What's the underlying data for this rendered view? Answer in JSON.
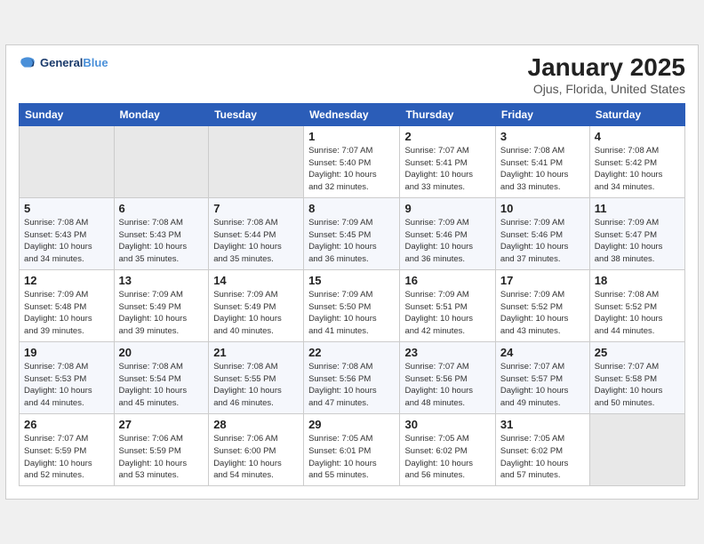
{
  "logo": {
    "text_general": "General",
    "text_blue": "Blue"
  },
  "title": "January 2025",
  "subtitle": "Ojus, Florida, United States",
  "weekdays": [
    "Sunday",
    "Monday",
    "Tuesday",
    "Wednesday",
    "Thursday",
    "Friday",
    "Saturday"
  ],
  "weeks": [
    [
      {
        "day": "",
        "info": ""
      },
      {
        "day": "",
        "info": ""
      },
      {
        "day": "",
        "info": ""
      },
      {
        "day": "1",
        "info": "Sunrise: 7:07 AM\nSunset: 5:40 PM\nDaylight: 10 hours\nand 32 minutes."
      },
      {
        "day": "2",
        "info": "Sunrise: 7:07 AM\nSunset: 5:41 PM\nDaylight: 10 hours\nand 33 minutes."
      },
      {
        "day": "3",
        "info": "Sunrise: 7:08 AM\nSunset: 5:41 PM\nDaylight: 10 hours\nand 33 minutes."
      },
      {
        "day": "4",
        "info": "Sunrise: 7:08 AM\nSunset: 5:42 PM\nDaylight: 10 hours\nand 34 minutes."
      }
    ],
    [
      {
        "day": "5",
        "info": "Sunrise: 7:08 AM\nSunset: 5:43 PM\nDaylight: 10 hours\nand 34 minutes."
      },
      {
        "day": "6",
        "info": "Sunrise: 7:08 AM\nSunset: 5:43 PM\nDaylight: 10 hours\nand 35 minutes."
      },
      {
        "day": "7",
        "info": "Sunrise: 7:08 AM\nSunset: 5:44 PM\nDaylight: 10 hours\nand 35 minutes."
      },
      {
        "day": "8",
        "info": "Sunrise: 7:09 AM\nSunset: 5:45 PM\nDaylight: 10 hours\nand 36 minutes."
      },
      {
        "day": "9",
        "info": "Sunrise: 7:09 AM\nSunset: 5:46 PM\nDaylight: 10 hours\nand 36 minutes."
      },
      {
        "day": "10",
        "info": "Sunrise: 7:09 AM\nSunset: 5:46 PM\nDaylight: 10 hours\nand 37 minutes."
      },
      {
        "day": "11",
        "info": "Sunrise: 7:09 AM\nSunset: 5:47 PM\nDaylight: 10 hours\nand 38 minutes."
      }
    ],
    [
      {
        "day": "12",
        "info": "Sunrise: 7:09 AM\nSunset: 5:48 PM\nDaylight: 10 hours\nand 39 minutes."
      },
      {
        "day": "13",
        "info": "Sunrise: 7:09 AM\nSunset: 5:49 PM\nDaylight: 10 hours\nand 39 minutes."
      },
      {
        "day": "14",
        "info": "Sunrise: 7:09 AM\nSunset: 5:49 PM\nDaylight: 10 hours\nand 40 minutes."
      },
      {
        "day": "15",
        "info": "Sunrise: 7:09 AM\nSunset: 5:50 PM\nDaylight: 10 hours\nand 41 minutes."
      },
      {
        "day": "16",
        "info": "Sunrise: 7:09 AM\nSunset: 5:51 PM\nDaylight: 10 hours\nand 42 minutes."
      },
      {
        "day": "17",
        "info": "Sunrise: 7:09 AM\nSunset: 5:52 PM\nDaylight: 10 hours\nand 43 minutes."
      },
      {
        "day": "18",
        "info": "Sunrise: 7:08 AM\nSunset: 5:52 PM\nDaylight: 10 hours\nand 44 minutes."
      }
    ],
    [
      {
        "day": "19",
        "info": "Sunrise: 7:08 AM\nSunset: 5:53 PM\nDaylight: 10 hours\nand 44 minutes."
      },
      {
        "day": "20",
        "info": "Sunrise: 7:08 AM\nSunset: 5:54 PM\nDaylight: 10 hours\nand 45 minutes."
      },
      {
        "day": "21",
        "info": "Sunrise: 7:08 AM\nSunset: 5:55 PM\nDaylight: 10 hours\nand 46 minutes."
      },
      {
        "day": "22",
        "info": "Sunrise: 7:08 AM\nSunset: 5:56 PM\nDaylight: 10 hours\nand 47 minutes."
      },
      {
        "day": "23",
        "info": "Sunrise: 7:07 AM\nSunset: 5:56 PM\nDaylight: 10 hours\nand 48 minutes."
      },
      {
        "day": "24",
        "info": "Sunrise: 7:07 AM\nSunset: 5:57 PM\nDaylight: 10 hours\nand 49 minutes."
      },
      {
        "day": "25",
        "info": "Sunrise: 7:07 AM\nSunset: 5:58 PM\nDaylight: 10 hours\nand 50 minutes."
      }
    ],
    [
      {
        "day": "26",
        "info": "Sunrise: 7:07 AM\nSunset: 5:59 PM\nDaylight: 10 hours\nand 52 minutes."
      },
      {
        "day": "27",
        "info": "Sunrise: 7:06 AM\nSunset: 5:59 PM\nDaylight: 10 hours\nand 53 minutes."
      },
      {
        "day": "28",
        "info": "Sunrise: 7:06 AM\nSunset: 6:00 PM\nDaylight: 10 hours\nand 54 minutes."
      },
      {
        "day": "29",
        "info": "Sunrise: 7:05 AM\nSunset: 6:01 PM\nDaylight: 10 hours\nand 55 minutes."
      },
      {
        "day": "30",
        "info": "Sunrise: 7:05 AM\nSunset: 6:02 PM\nDaylight: 10 hours\nand 56 minutes."
      },
      {
        "day": "31",
        "info": "Sunrise: 7:05 AM\nSunset: 6:02 PM\nDaylight: 10 hours\nand 57 minutes."
      },
      {
        "day": "",
        "info": ""
      }
    ]
  ]
}
